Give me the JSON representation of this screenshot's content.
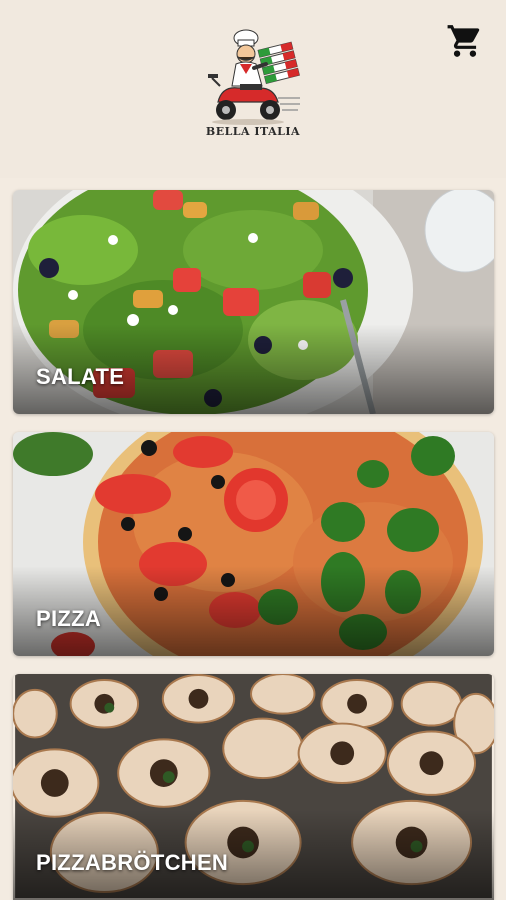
{
  "header": {
    "brand_name": "BELLA ITALIA",
    "logo_icon": "pizza-delivery-scooter-logo",
    "cart_icon": "shopping-cart-icon"
  },
  "categories": [
    {
      "label": "SALATE"
    },
    {
      "label": "PIZZA"
    },
    {
      "label": "PIZZABRÖTCHEN"
    }
  ],
  "colors": {
    "background": "#f3ebe1",
    "label_text": "#ffffff",
    "icon": "#111111"
  }
}
